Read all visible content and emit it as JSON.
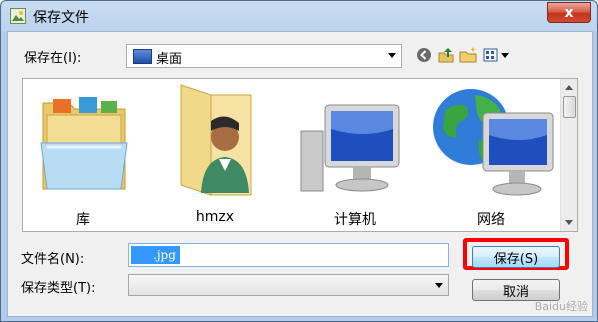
{
  "window": {
    "title": "保存文件",
    "close_glyph": "x"
  },
  "location": {
    "label": "保存在(I):",
    "value": "桌面"
  },
  "toolbar": {
    "icons": [
      "back-icon",
      "up-folder-icon",
      "new-folder-icon",
      "view-menu-icon"
    ]
  },
  "items": [
    {
      "label": "库",
      "icon": "libraries-icon"
    },
    {
      "label": "hmzx",
      "icon": "user-folder-icon"
    },
    {
      "label": "计算机",
      "icon": "computer-icon"
    },
    {
      "label": "网络",
      "icon": "network-icon"
    }
  ],
  "filename": {
    "label": "文件名(N):",
    "value": ".jpg"
  },
  "filetype": {
    "label": "保存类型(T):",
    "value": ""
  },
  "buttons": {
    "save": "保存(S)",
    "cancel": "取消"
  },
  "watermark": "Baidu经验",
  "colors": {
    "highlight": "#ff0000",
    "selection": "#3399ff",
    "title_bar": "#bcd3ee",
    "close": "#c2341c"
  }
}
